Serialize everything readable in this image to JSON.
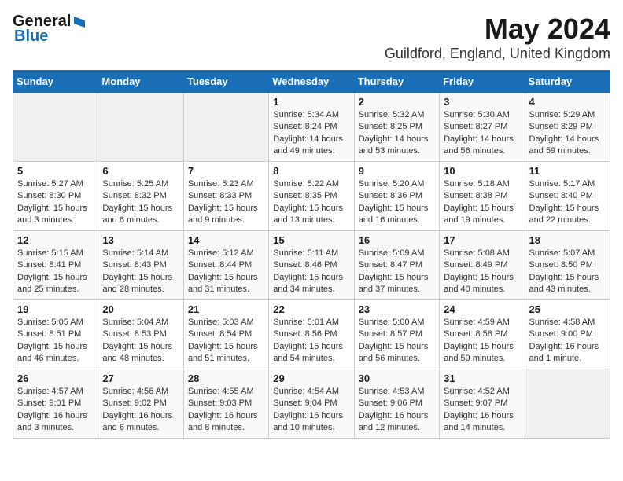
{
  "logo": {
    "general": "General",
    "blue": "Blue"
  },
  "title": "May 2024",
  "subtitle": "Guildford, England, United Kingdom",
  "days_of_week": [
    "Sunday",
    "Monday",
    "Tuesday",
    "Wednesday",
    "Thursday",
    "Friday",
    "Saturday"
  ],
  "weeks": [
    [
      {
        "day": "",
        "info": ""
      },
      {
        "day": "",
        "info": ""
      },
      {
        "day": "",
        "info": ""
      },
      {
        "day": "1",
        "info": "Sunrise: 5:34 AM\nSunset: 8:24 PM\nDaylight: 14 hours and 49 minutes."
      },
      {
        "day": "2",
        "info": "Sunrise: 5:32 AM\nSunset: 8:25 PM\nDaylight: 14 hours and 53 minutes."
      },
      {
        "day": "3",
        "info": "Sunrise: 5:30 AM\nSunset: 8:27 PM\nDaylight: 14 hours and 56 minutes."
      },
      {
        "day": "4",
        "info": "Sunrise: 5:29 AM\nSunset: 8:29 PM\nDaylight: 14 hours and 59 minutes."
      }
    ],
    [
      {
        "day": "5",
        "info": "Sunrise: 5:27 AM\nSunset: 8:30 PM\nDaylight: 15 hours and 3 minutes."
      },
      {
        "day": "6",
        "info": "Sunrise: 5:25 AM\nSunset: 8:32 PM\nDaylight: 15 hours and 6 minutes."
      },
      {
        "day": "7",
        "info": "Sunrise: 5:23 AM\nSunset: 8:33 PM\nDaylight: 15 hours and 9 minutes."
      },
      {
        "day": "8",
        "info": "Sunrise: 5:22 AM\nSunset: 8:35 PM\nDaylight: 15 hours and 13 minutes."
      },
      {
        "day": "9",
        "info": "Sunrise: 5:20 AM\nSunset: 8:36 PM\nDaylight: 15 hours and 16 minutes."
      },
      {
        "day": "10",
        "info": "Sunrise: 5:18 AM\nSunset: 8:38 PM\nDaylight: 15 hours and 19 minutes."
      },
      {
        "day": "11",
        "info": "Sunrise: 5:17 AM\nSunset: 8:40 PM\nDaylight: 15 hours and 22 minutes."
      }
    ],
    [
      {
        "day": "12",
        "info": "Sunrise: 5:15 AM\nSunset: 8:41 PM\nDaylight: 15 hours and 25 minutes."
      },
      {
        "day": "13",
        "info": "Sunrise: 5:14 AM\nSunset: 8:43 PM\nDaylight: 15 hours and 28 minutes."
      },
      {
        "day": "14",
        "info": "Sunrise: 5:12 AM\nSunset: 8:44 PM\nDaylight: 15 hours and 31 minutes."
      },
      {
        "day": "15",
        "info": "Sunrise: 5:11 AM\nSunset: 8:46 PM\nDaylight: 15 hours and 34 minutes."
      },
      {
        "day": "16",
        "info": "Sunrise: 5:09 AM\nSunset: 8:47 PM\nDaylight: 15 hours and 37 minutes."
      },
      {
        "day": "17",
        "info": "Sunrise: 5:08 AM\nSunset: 8:49 PM\nDaylight: 15 hours and 40 minutes."
      },
      {
        "day": "18",
        "info": "Sunrise: 5:07 AM\nSunset: 8:50 PM\nDaylight: 15 hours and 43 minutes."
      }
    ],
    [
      {
        "day": "19",
        "info": "Sunrise: 5:05 AM\nSunset: 8:51 PM\nDaylight: 15 hours and 46 minutes."
      },
      {
        "day": "20",
        "info": "Sunrise: 5:04 AM\nSunset: 8:53 PM\nDaylight: 15 hours and 48 minutes."
      },
      {
        "day": "21",
        "info": "Sunrise: 5:03 AM\nSunset: 8:54 PM\nDaylight: 15 hours and 51 minutes."
      },
      {
        "day": "22",
        "info": "Sunrise: 5:01 AM\nSunset: 8:56 PM\nDaylight: 15 hours and 54 minutes."
      },
      {
        "day": "23",
        "info": "Sunrise: 5:00 AM\nSunset: 8:57 PM\nDaylight: 15 hours and 56 minutes."
      },
      {
        "day": "24",
        "info": "Sunrise: 4:59 AM\nSunset: 8:58 PM\nDaylight: 15 hours and 59 minutes."
      },
      {
        "day": "25",
        "info": "Sunrise: 4:58 AM\nSunset: 9:00 PM\nDaylight: 16 hours and 1 minute."
      }
    ],
    [
      {
        "day": "26",
        "info": "Sunrise: 4:57 AM\nSunset: 9:01 PM\nDaylight: 16 hours and 3 minutes."
      },
      {
        "day": "27",
        "info": "Sunrise: 4:56 AM\nSunset: 9:02 PM\nDaylight: 16 hours and 6 minutes."
      },
      {
        "day": "28",
        "info": "Sunrise: 4:55 AM\nSunset: 9:03 PM\nDaylight: 16 hours and 8 minutes."
      },
      {
        "day": "29",
        "info": "Sunrise: 4:54 AM\nSunset: 9:04 PM\nDaylight: 16 hours and 10 minutes."
      },
      {
        "day": "30",
        "info": "Sunrise: 4:53 AM\nSunset: 9:06 PM\nDaylight: 16 hours and 12 minutes."
      },
      {
        "day": "31",
        "info": "Sunrise: 4:52 AM\nSunset: 9:07 PM\nDaylight: 16 hours and 14 minutes."
      },
      {
        "day": "",
        "info": ""
      }
    ]
  ]
}
